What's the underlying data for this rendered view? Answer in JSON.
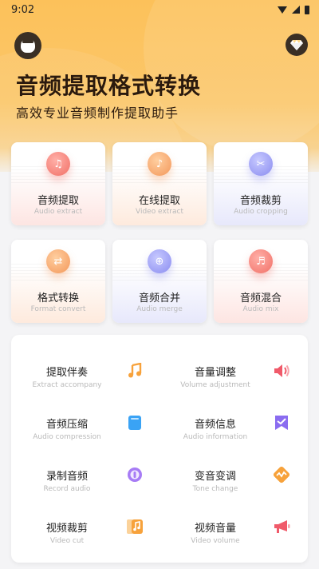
{
  "status_bar": {
    "time": "9:02"
  },
  "header": {
    "title": "音频提取格式转换",
    "subtitle": "高效专业音频制作提取助手"
  },
  "feature_cards": [
    {
      "label": "音频提取",
      "sub": "Audio extract",
      "color": "#f16f66",
      "icon": "audio-extract-icon"
    },
    {
      "label": "在线提取",
      "sub": "Video extract",
      "color": "#f3975a",
      "icon": "video-extract-icon"
    },
    {
      "label": "音频裁剪",
      "sub": "Audio cropping",
      "color": "#8a8cf0",
      "icon": "scissors-icon"
    },
    {
      "label": "格式转换",
      "sub": "Format convert",
      "color": "#f3975a",
      "icon": "format-convert-icon"
    },
    {
      "label": "音频合并",
      "sub": "Audio merge",
      "color": "#8a8cf0",
      "icon": "merge-icon"
    },
    {
      "label": "音频混合",
      "sub": "Audio mix",
      "color": "#f16f66",
      "icon": "mix-icon"
    }
  ],
  "tools": [
    {
      "label": "提取伴奏",
      "sub": "Extract accompany",
      "icon": "music-note-icon",
      "color": "#f7a23b"
    },
    {
      "label": "音量调整",
      "sub": "Volume adjustment",
      "icon": "speaker-icon",
      "color": "#f05a6a"
    },
    {
      "label": "音频压缩",
      "sub": "Audio compression",
      "icon": "book-icon",
      "color": "#3aa3f5"
    },
    {
      "label": "音频信息",
      "sub": "Audio information",
      "icon": "bookmark-icon",
      "color": "#8a6cf0"
    },
    {
      "label": "录制音频",
      "sub": "Record audio",
      "icon": "record-icon",
      "color": "#a77cf5"
    },
    {
      "label": "变音变调",
      "sub": "Tone change",
      "icon": "wave-icon",
      "color": "#f7a23b"
    },
    {
      "label": "视频裁剪",
      "sub": "Video cut",
      "icon": "video-music-icon",
      "color": "#f7a23b"
    },
    {
      "label": "视频音量",
      "sub": "Video volume",
      "icon": "megaphone-icon",
      "color": "#f05a6a"
    }
  ]
}
